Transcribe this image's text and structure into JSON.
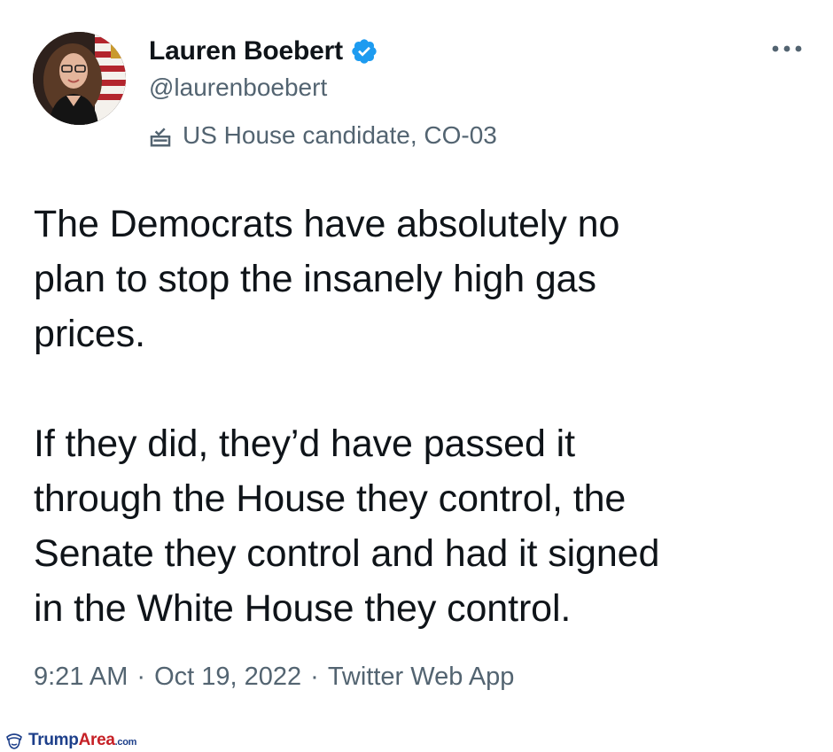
{
  "author": {
    "display_name": "Lauren Boebert",
    "handle": "@laurenboebert",
    "label": "US House candidate, CO-03",
    "verified_icon": "verified-badge-icon",
    "label_icon": "ballot-box-icon"
  },
  "tweet": {
    "paragraphs": [
      "The Democrats have absolutely no\nplan to stop the insanely high gas\nprices.",
      "If they did, they’d have passed it\nthrough the House they control, the\nSenate they control and had it signed\nin the White House they control."
    ]
  },
  "meta": {
    "time": "9:21 AM",
    "separator": "·",
    "date": "Oct 19, 2022",
    "source": "Twitter Web App"
  },
  "watermark": {
    "brand_main": "Trump",
    "brand_accent": "Area",
    "brand_suffix": ".com"
  },
  "colors": {
    "text_primary": "#0f1419",
    "text_secondary": "#536471",
    "verified_blue": "#1d9bf0",
    "watermark_blue": "#1d3f8a",
    "watermark_red": "#c62026"
  }
}
